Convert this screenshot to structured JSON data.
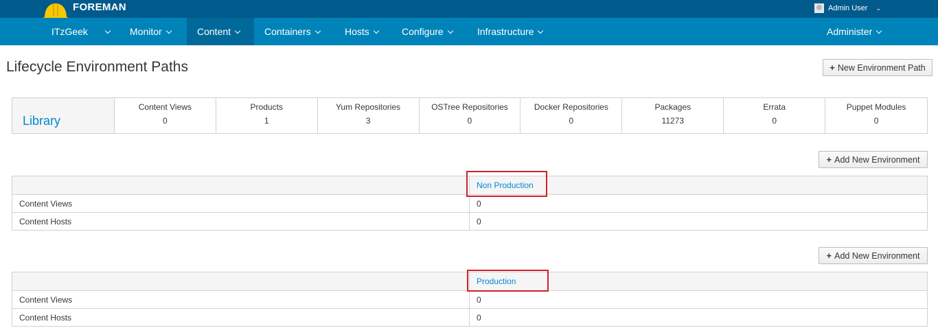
{
  "brand": {
    "name": "FOREMAN",
    "logo_icon": "helmet-icon",
    "logo_color": "#f6c800"
  },
  "user_menu": {
    "label": "Admin User",
    "icon": "user-avatar-icon"
  },
  "nav": {
    "items": [
      {
        "label": "ITzGeek"
      },
      {
        "label": "Monitor"
      },
      {
        "label": "Content"
      },
      {
        "label": "Containers"
      },
      {
        "label": "Hosts"
      },
      {
        "label": "Configure"
      },
      {
        "label": "Infrastructure"
      },
      {
        "label": "Administer"
      }
    ],
    "active": "Content"
  },
  "page": {
    "title": "Lifecycle Environment Paths",
    "new_path_button": "New Environment Path"
  },
  "library": {
    "name": "Library",
    "stats": [
      {
        "label": "Content Views",
        "value": "0"
      },
      {
        "label": "Products",
        "value": "1"
      },
      {
        "label": "Yum Repositories",
        "value": "3"
      },
      {
        "label": "OSTree Repositories",
        "value": "0"
      },
      {
        "label": "Docker Repositories",
        "value": "0"
      },
      {
        "label": "Packages",
        "value": "11273"
      },
      {
        "label": "Errata",
        "value": "0"
      },
      {
        "label": "Puppet Modules",
        "value": "0"
      }
    ]
  },
  "paths": [
    {
      "add_button": "Add New Environment",
      "environment": "Non Production",
      "rows": [
        {
          "label": "Content Views",
          "value": "0"
        },
        {
          "label": "Content Hosts",
          "value": "0"
        }
      ]
    },
    {
      "add_button": "Add New Environment",
      "environment": "Production",
      "rows": [
        {
          "label": "Content Views",
          "value": "0"
        },
        {
          "label": "Content Hosts",
          "value": "0"
        }
      ]
    }
  ],
  "colors": {
    "topbar": "#015a8c",
    "navbar": "#0083b9",
    "link": "#0088ce",
    "highlight": "#d0202a"
  }
}
